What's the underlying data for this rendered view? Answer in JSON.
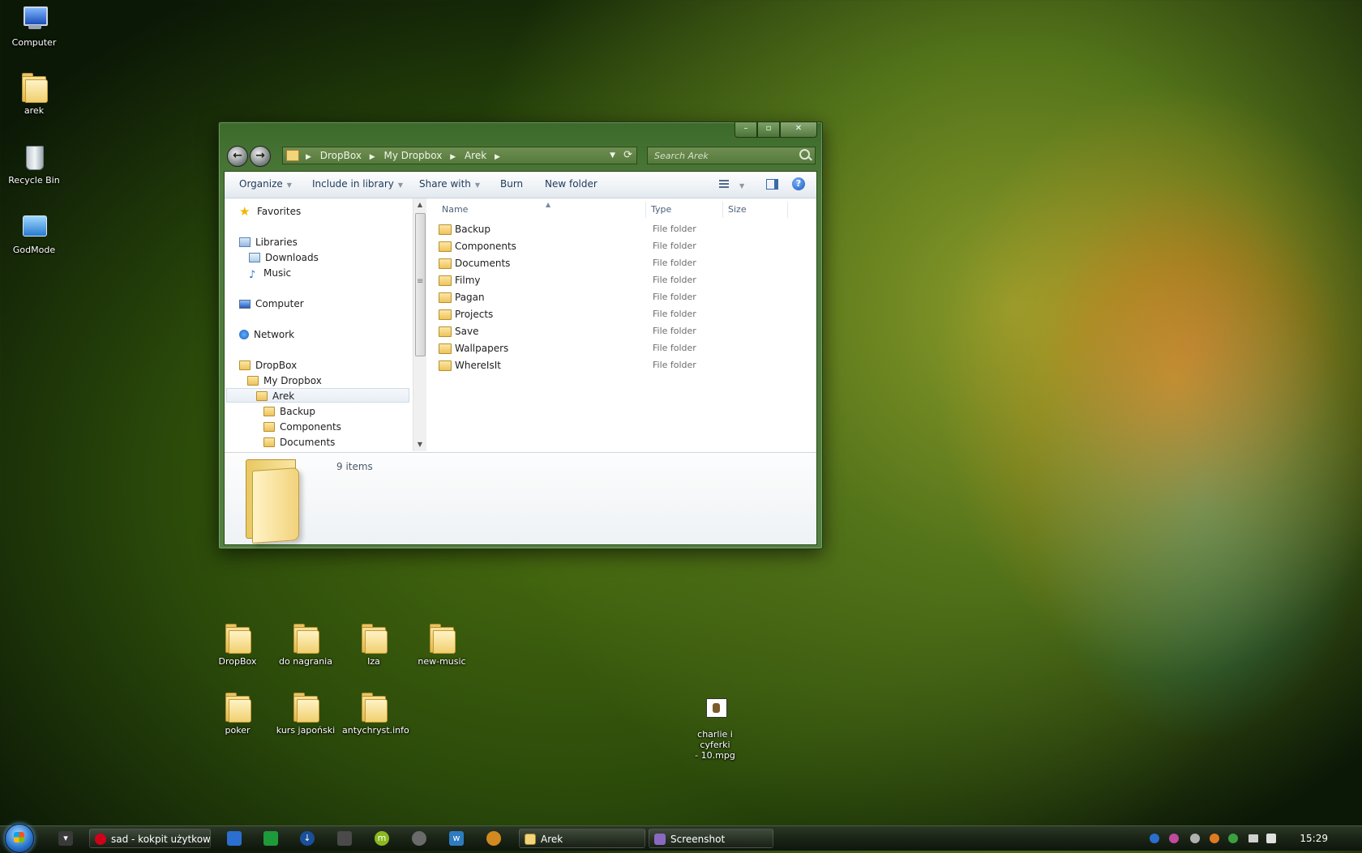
{
  "desktop": {
    "left_icons": [
      "Computer",
      "arek",
      "Recycle Bin",
      "GodMode"
    ],
    "folders_row1": [
      "DropBox",
      "do nagrania",
      "Iza",
      "new-music"
    ],
    "folders_row2": [
      "poker",
      "kurs japoński",
      "antychryst.info"
    ],
    "video": {
      "line1": "charlie i cyferki",
      "line2": "- 10.mpg"
    }
  },
  "window": {
    "caption": {
      "min": "–",
      "max": "▫",
      "close": "✕"
    },
    "address": {
      "crumbs": [
        "DropBox",
        "My Dropbox",
        "Arek"
      ],
      "sep": "▶"
    },
    "search_placeholder": "Search Arek",
    "toolbar": {
      "organize": "Organize",
      "include": "Include in library",
      "share": "Share with",
      "burn": "Burn",
      "newfolder": "New folder",
      "help": "?"
    },
    "nav": {
      "favorites": "Favorites",
      "libraries": "Libraries",
      "downloads": "Downloads",
      "music": "Music",
      "computer": "Computer",
      "network": "Network",
      "dropbox": "DropBox",
      "mydropbox": "My Dropbox",
      "arek": "Arek",
      "backup": "Backup",
      "components": "Components",
      "documents": "Documents"
    },
    "columns": {
      "name": "Name",
      "type": "Type",
      "size": "Size"
    },
    "files": [
      {
        "name": "Backup",
        "type": "File folder"
      },
      {
        "name": "Components",
        "type": "File folder"
      },
      {
        "name": "Documents",
        "type": "File folder"
      },
      {
        "name": "Filmy",
        "type": "File folder"
      },
      {
        "name": "Pagan",
        "type": "File folder"
      },
      {
        "name": "Projects",
        "type": "File folder"
      },
      {
        "name": "Save",
        "type": "File folder"
      },
      {
        "name": "Wallpapers",
        "type": "File folder"
      },
      {
        "name": "WhereIsIt",
        "type": "File folder"
      }
    ],
    "status": "9 items"
  },
  "taskbar": {
    "opera": "sad - kokpit użytkow...",
    "explorer": "Arek",
    "screenshot": "Screenshot",
    "clock": "15:29"
  },
  "colors": {
    "accent": "#4e7a3a",
    "link": "#1e395b"
  }
}
